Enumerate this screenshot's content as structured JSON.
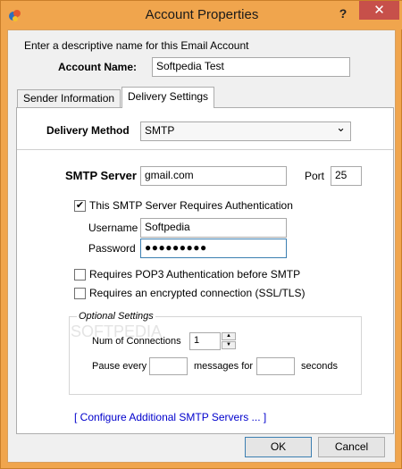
{
  "window": {
    "title": "Account Properties",
    "help_label": "?",
    "close_label": "✕"
  },
  "intro_text": "Enter a descriptive name for this Email Account",
  "account_name": {
    "label": "Account Name:",
    "value": "Softpedia Test"
  },
  "tabs": [
    {
      "label": "Sender Information",
      "active": false
    },
    {
      "label": "Delivery Settings",
      "active": true
    }
  ],
  "delivery": {
    "method_label": "Delivery Method",
    "method_value": "SMTP",
    "dropdown_arrow": "⌄"
  },
  "smtp": {
    "server_label": "SMTP Server",
    "server_value": "gmail.com",
    "port_label": "Port",
    "port_value": "25",
    "auth_label": "This SMTP Server Requires Authentication",
    "auth_checked": true,
    "username_label": "Username",
    "username_value": "Softpedia",
    "password_label": "Password",
    "password_value": "●●●●●●●●●",
    "pop3_label": "Requires POP3 Authentication before SMTP",
    "pop3_checked": false,
    "ssl_label": "Requires an encrypted connection (SSL/TLS)",
    "ssl_checked": false
  },
  "optional": {
    "title": "Optional Settings",
    "connections_label": "Num of Connections",
    "connections_value": "1",
    "pause_label": "Pause every",
    "pause_value": "",
    "messages_label": "messages for",
    "messages_value": "",
    "seconds_label": "seconds"
  },
  "configure_link": "[ Configure Additional SMTP Servers ... ]",
  "buttons": {
    "ok": "OK",
    "cancel": "Cancel"
  },
  "watermark": "SOFTPEDIA",
  "colors": {
    "titlebar": "#f0a54d",
    "close_button": "#c7504a",
    "link": "#0000cc"
  }
}
